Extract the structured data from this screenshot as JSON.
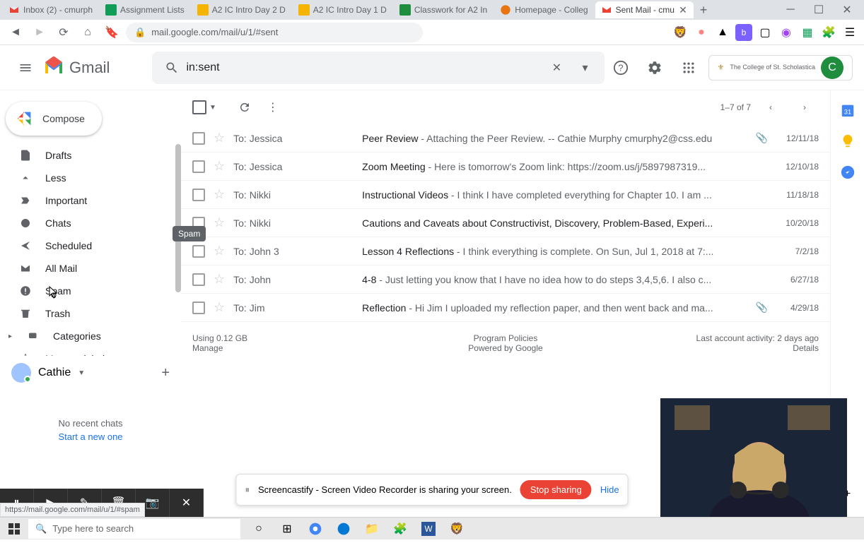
{
  "browser": {
    "tabs": [
      {
        "label": "Inbox (2) - cmurph",
        "favicon": "gmail"
      },
      {
        "label": "Assignment Lists",
        "favicon": "sheets"
      },
      {
        "label": "A2 IC Intro Day 2 D",
        "favicon": "slides"
      },
      {
        "label": "A2 IC Intro Day 1 D",
        "favicon": "slides"
      },
      {
        "label": "Classwork for A2 In",
        "favicon": "classroom"
      },
      {
        "label": "Homepage - Colleg",
        "favicon": "brightspace"
      },
      {
        "label": "Sent Mail - cmu",
        "favicon": "gmail",
        "active": true
      }
    ],
    "url": "mail.google.com/mail/u/1/#sent",
    "status_url": "https://mail.google.com/mail/u/1/#spam"
  },
  "gmail": {
    "brand": "Gmail",
    "search_value": "in:sent",
    "org": "The College of St. Scholastica",
    "avatar_initial": "C"
  },
  "compose_label": "Compose",
  "sidebar": {
    "items": [
      {
        "icon": "drafts",
        "label": "Drafts"
      },
      {
        "icon": "less",
        "label": "Less"
      },
      {
        "icon": "important",
        "label": "Important"
      },
      {
        "icon": "chats",
        "label": "Chats"
      },
      {
        "icon": "scheduled",
        "label": "Scheduled"
      },
      {
        "icon": "allmail",
        "label": "All Mail"
      },
      {
        "icon": "spam",
        "label": "Spam"
      },
      {
        "icon": "trash",
        "label": "Trash"
      },
      {
        "icon": "categories",
        "label": "Categories"
      },
      {
        "icon": "manage",
        "label": "Manage labels"
      }
    ],
    "tooltip": "Spam"
  },
  "hangouts": {
    "name": "Cathie",
    "no_chats": "No recent chats",
    "start": "Start a new one"
  },
  "toolbar": {
    "range": "1–7 of 7"
  },
  "emails": [
    {
      "to": "To: Jessica",
      "subject": "Peer Review",
      "preview": " - Attaching the Peer Review. -- Cathie Murphy cmurphy2@css.edu",
      "attach": true,
      "date": "12/11/18"
    },
    {
      "to": "To: Jessica",
      "subject": "Zoom Meeting",
      "preview": " - Here is tomorrow's Zoom link: https://zoom.us/j/5897987319...",
      "attach": false,
      "date": "12/10/18"
    },
    {
      "to": "To: Nikki",
      "subject": "Instructional Videos",
      "preview": " - I think I have completed everything for Chapter 10. I am ...",
      "attach": false,
      "date": "11/18/18"
    },
    {
      "to": "To: Nikki",
      "subject": "Cautions and Caveats about Constructivist, Discovery, Problem-Based, Experi...",
      "preview": "",
      "attach": false,
      "date": "10/20/18"
    },
    {
      "to": "To: John 3",
      "subject": "Lesson 4 Reflections",
      "preview": " - I think everything is complete. On Sun, Jul 1, 2018 at 7:...",
      "attach": false,
      "date": "7/2/18"
    },
    {
      "to": "To: John",
      "subject": "4-8",
      "preview": " - Just letting you know that I have no idea how to do steps 3,4,5,6. I also c...",
      "attach": false,
      "date": "6/27/18"
    },
    {
      "to": "To: Jim",
      "subject": "Reflection",
      "preview": " - Hi Jim I uploaded my reflection paper, and then went back and ma...",
      "attach": true,
      "date": "4/29/18"
    }
  ],
  "footer": {
    "storage": "Using 0.12 GB",
    "manage": "Manage",
    "policies": "Program Policies",
    "powered": "Powered by Google",
    "activity": "Last account activity: 2 days ago",
    "details": "Details"
  },
  "screencast": {
    "msg": "Screencastify - Screen Video Recorder is sharing your screen.",
    "stop": "Stop sharing",
    "hide": "Hide"
  },
  "taskbar": {
    "search_placeholder": "Type here to search"
  }
}
